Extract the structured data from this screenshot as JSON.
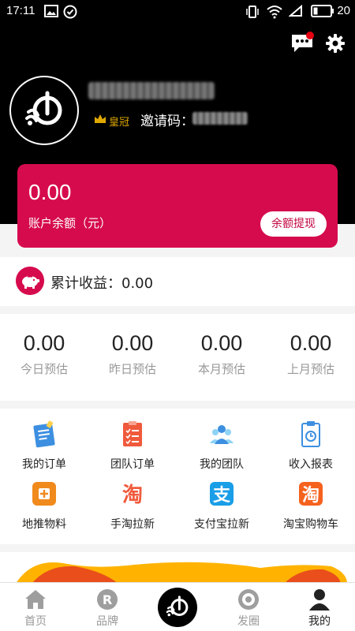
{
  "status_bar": {
    "time": "17:11",
    "battery": "20"
  },
  "profile": {
    "level": "皇冠",
    "invite_label": "邀请码："
  },
  "balance": {
    "amount": "0.00",
    "label": "账户余额（元）",
    "withdraw_label": "余额提现"
  },
  "cumulative": {
    "label": "累计收益：0.00"
  },
  "estimates": [
    {
      "value": "0.00",
      "label": "今日预估"
    },
    {
      "value": "0.00",
      "label": "昨日预估"
    },
    {
      "value": "0.00",
      "label": "本月预估"
    },
    {
      "value": "0.00",
      "label": "上月预估"
    }
  ],
  "features": [
    {
      "label": "我的订单",
      "icon": "order-icon"
    },
    {
      "label": "团队订单",
      "icon": "team-order-icon"
    },
    {
      "label": "我的团队",
      "icon": "team-icon"
    },
    {
      "label": "收入报表",
      "icon": "report-icon"
    },
    {
      "label": "地推物料",
      "icon": "material-icon"
    },
    {
      "label": "手淘拉新",
      "icon": "taobao-icon"
    },
    {
      "label": "支付宝拉新",
      "icon": "alipay-icon"
    },
    {
      "label": "淘宝购物车",
      "icon": "cart-icon"
    }
  ],
  "tabs": [
    {
      "label": "首页",
      "icon": "home-icon"
    },
    {
      "label": "品牌",
      "icon": "brand-icon"
    },
    {
      "label": "发圈",
      "icon": "moments-icon"
    },
    {
      "label": "我的",
      "icon": "profile-icon"
    }
  ],
  "colors": {
    "accent": "#d60b4d",
    "header_bg": "#000000",
    "notify_dot": "#e60012"
  }
}
